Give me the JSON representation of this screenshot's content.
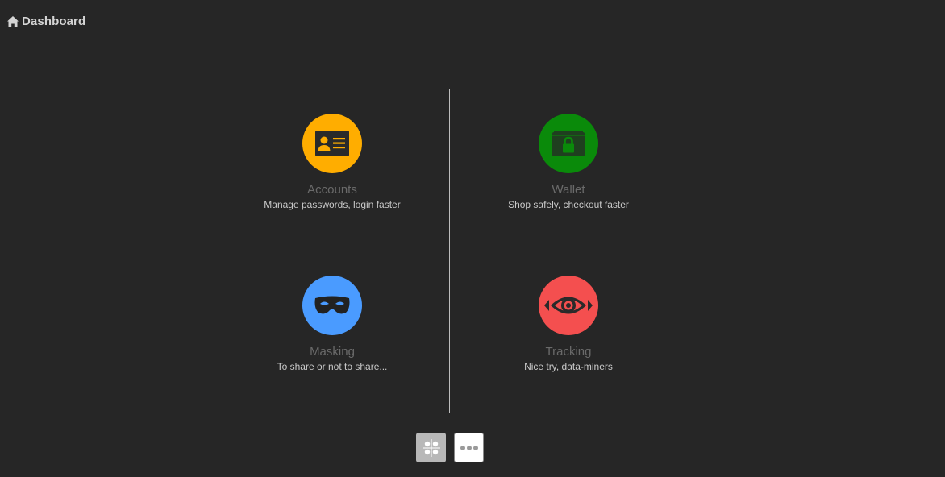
{
  "header": {
    "title": "Dashboard",
    "icon": "home-icon"
  },
  "tiles": [
    {
      "title": "Accounts",
      "subtitle": "Manage passwords, login faster",
      "icon": "id-card-icon",
      "color": "#ffad00"
    },
    {
      "title": "Wallet",
      "subtitle": "Shop safely, checkout faster",
      "icon": "wallet-lock-icon",
      "color": "#0a8a0a"
    },
    {
      "title": "Masking",
      "subtitle": "To share or not to share...",
      "icon": "mask-icon",
      "color": "#4a9bff"
    },
    {
      "title": "Tracking",
      "subtitle": "Nice try, data-miners",
      "icon": "eye-icon",
      "color": "#f44f4f"
    }
  ],
  "bottom_buttons": [
    {
      "icon": "grid-icon"
    },
    {
      "icon": "more-icon"
    }
  ],
  "colors": {
    "background": "#262626",
    "divider": "#bdbdbd"
  }
}
